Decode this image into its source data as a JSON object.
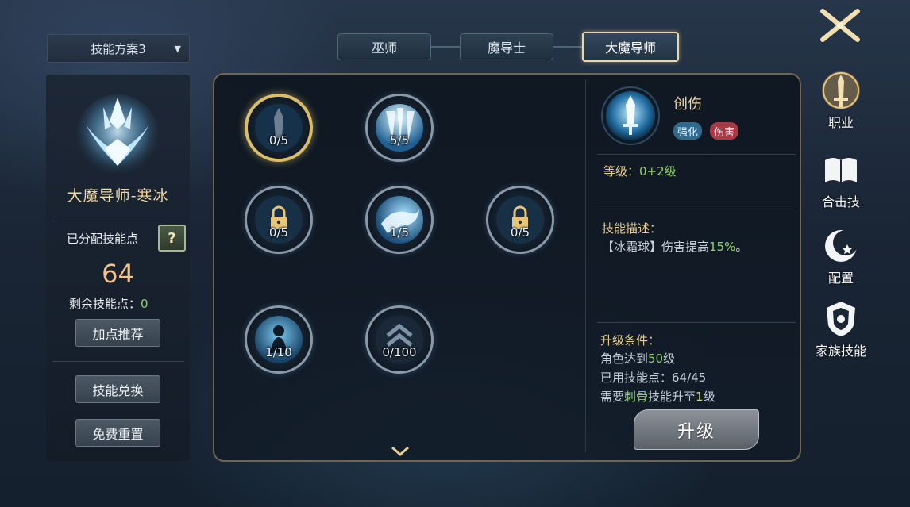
{
  "plan_select": {
    "label": "技能方案3"
  },
  "left_panel": {
    "class_name": "大魔导师-寒冰",
    "assigned_label": "已分配技能点",
    "help_label": "?",
    "assigned_points": "64",
    "remaining_label": "剩余技能点：",
    "remaining_value": "0",
    "buttons": {
      "recommend": "加点推荐",
      "exchange": "技能兑换",
      "reset": "免费重置"
    }
  },
  "tabs": [
    {
      "label": "巫师",
      "active": false
    },
    {
      "label": "魔导士",
      "active": false
    },
    {
      "label": "大魔导师",
      "active": true
    }
  ],
  "skill_tree": {
    "nodes": [
      {
        "count": "0/5",
        "icon": "ice-blade-icon",
        "selected": true
      },
      {
        "count": "5/5",
        "icon": "ice-shards-icon",
        "selected": false
      },
      {
        "count": "0/5",
        "icon": "lock-icon",
        "selected": false
      },
      {
        "count": "1/5",
        "icon": "ice-dragon-icon",
        "selected": false
      },
      {
        "count": "0/5",
        "icon": "lock-icon",
        "selected": false
      },
      {
        "count": "1/10",
        "icon": "frost-mage-icon",
        "selected": false
      },
      {
        "count": "0/100",
        "icon": "chevron-up-icon",
        "selected": false
      }
    ]
  },
  "detail": {
    "skill_name": "创伤",
    "tags": [
      "强化",
      "伤害"
    ],
    "level_label": "等级：",
    "level_value": "0+2级",
    "desc_title": "技能描述：",
    "desc_prefix": "【冰霜球】伤害提高",
    "desc_highlight": "15%",
    "desc_suffix": "。",
    "req_title": "升级条件：",
    "req_1_prefix": "角色达到",
    "req_1_value": "50",
    "req_1_suffix": "级",
    "req_2_prefix": "已用技能点：",
    "req_2_value": "64/45",
    "req_3_prefix": "需要",
    "req_3_skill": "刺骨",
    "req_3_mid": "技能升至",
    "req_3_value": "1",
    "req_3_suffix": "级",
    "upgrade_label": "升级"
  },
  "right_nav": {
    "items": [
      {
        "label": "职业",
        "icon": "sword-icon"
      },
      {
        "label": "合击技",
        "icon": "book-icon"
      },
      {
        "label": "配置",
        "icon": "moon-icon"
      },
      {
        "label": "家族技能",
        "icon": "crest-icon"
      }
    ]
  },
  "colors": {
    "accent_gold": "#e8d9a0",
    "highlight_green": "#8ed16a",
    "damage_red": "#a93a45",
    "enhance_blue": "#2f6b8f"
  }
}
